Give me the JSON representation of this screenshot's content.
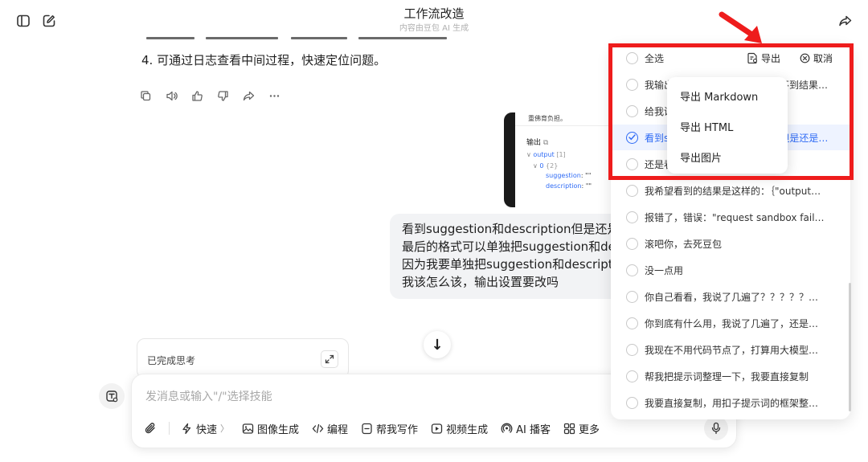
{
  "header": {
    "title": "工作流改造",
    "subtitle": "内容由豆包 AI 生成",
    "left_icons": [
      "sidebar-toggle-icon",
      "new-chat-icon"
    ],
    "right_icon": "share-icon"
  },
  "chat": {
    "step_text": "4. 可通过日志查看中间过程，快速定位问题。",
    "message_actions": [
      "copy-icon",
      "speaker-icon",
      "thumbs-up-icon",
      "thumbs-down-icon",
      "share-icon",
      "more-icon"
    ],
    "code_preview": {
      "top_text": "重佛育负担。",
      "section_label": "输出",
      "tree_output": "output",
      "tree_output_count": "[1]",
      "tree_zero": "0",
      "tree_zero_count": "{2}",
      "field1_key": "suggestion",
      "field1_val": ": \"\"",
      "field2_key": "description",
      "field2_val": ": \"\""
    },
    "user_message_lines": [
      "看到suggestion和description但是还是",
      "最后的格式可以单独把suggestion和de",
      "因为我要单独把suggestion和descript",
      "我该怎么该，输出设置要改吗"
    ],
    "thinking_label": "已完成思考"
  },
  "input": {
    "placeholder": "发消息或输入\"/\"选择技能",
    "tools": [
      {
        "icon": "lightning-icon",
        "label": "快速"
      },
      {
        "icon": "image-icon",
        "label": "图像生成"
      },
      {
        "icon": "code-icon",
        "label": "编程"
      },
      {
        "icon": "write-icon",
        "label": "帮我写作"
      },
      {
        "icon": "video-icon",
        "label": "视频生成"
      },
      {
        "icon": "podcast-icon",
        "label": "AI 播客"
      },
      {
        "icon": "grid-icon",
        "label": "更多"
      }
    ]
  },
  "history_panel": {
    "select_all": "全选",
    "export": "导出",
    "cancel": "取消",
    "items": [
      {
        "text": "我输出的设置都是对的，但是看不到结果…",
        "checked": false
      },
      {
        "text": "给我讲讲这个工作流是怎么回事",
        "checked": false
      },
      {
        "text": "看到suggestion和description但是还是…",
        "checked": true
      },
      {
        "text": "还是看不到结果",
        "checked": false
      },
      {
        "text": "我希望看到的结果是这样的：｛\"output…",
        "checked": false
      },
      {
        "text": "报错了，错误：\"request sandbox faile…",
        "checked": false
      },
      {
        "text": "滚吧你，去死豆包",
        "checked": false
      },
      {
        "text": "没一点用",
        "checked": false
      },
      {
        "text": "你自己看看，我说了几遍了？？？？？…",
        "checked": false
      },
      {
        "text": "你到底有什么用，我说了几遍了，还是…",
        "checked": false
      },
      {
        "text": "我现在不用代码节点了，打算用大模型…",
        "checked": false
      },
      {
        "text": "帮我把提示词整理一下，我要直接复制",
        "checked": false
      },
      {
        "text": "我要直接复制，用扣子提示词的框架整…",
        "checked": false
      }
    ]
  },
  "export_menu": {
    "items": [
      "导出 Markdown",
      "导出 HTML",
      "导出图片"
    ]
  },
  "colors": {
    "accent": "#2f6bf5",
    "annotation_red": "#ee1c1c",
    "bubble_bg": "#f2f3f5"
  }
}
